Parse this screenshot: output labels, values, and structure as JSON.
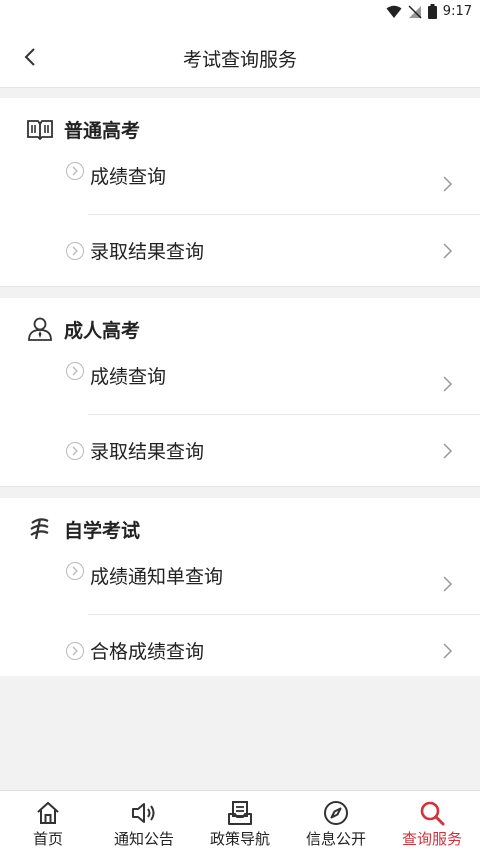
{
  "status": {
    "time": "9:17"
  },
  "header": {
    "title": "考试查询服务"
  },
  "sections": [
    {
      "title": "普通高考",
      "icon": "book-icon",
      "items": [
        {
          "label": "成绩查询"
        },
        {
          "label": "录取结果查询"
        }
      ]
    },
    {
      "title": "成人高考",
      "icon": "person-icon",
      "items": [
        {
          "label": "成绩查询"
        },
        {
          "label": "录取结果查询"
        }
      ]
    },
    {
      "title": "自学考试",
      "icon": "self-study-icon",
      "items": [
        {
          "label": "成绩通知单查询"
        },
        {
          "label": "合格成绩查询"
        }
      ]
    }
  ],
  "nav": {
    "items": [
      {
        "label": "首页",
        "icon": "home-icon"
      },
      {
        "label": "通知公告",
        "icon": "speaker-icon"
      },
      {
        "label": "政策导航",
        "icon": "document-icon"
      },
      {
        "label": "信息公开",
        "icon": "compass-icon"
      },
      {
        "label": "查询服务",
        "icon": "search-icon"
      }
    ],
    "active_index": 4,
    "active_color": "#d6303a"
  }
}
